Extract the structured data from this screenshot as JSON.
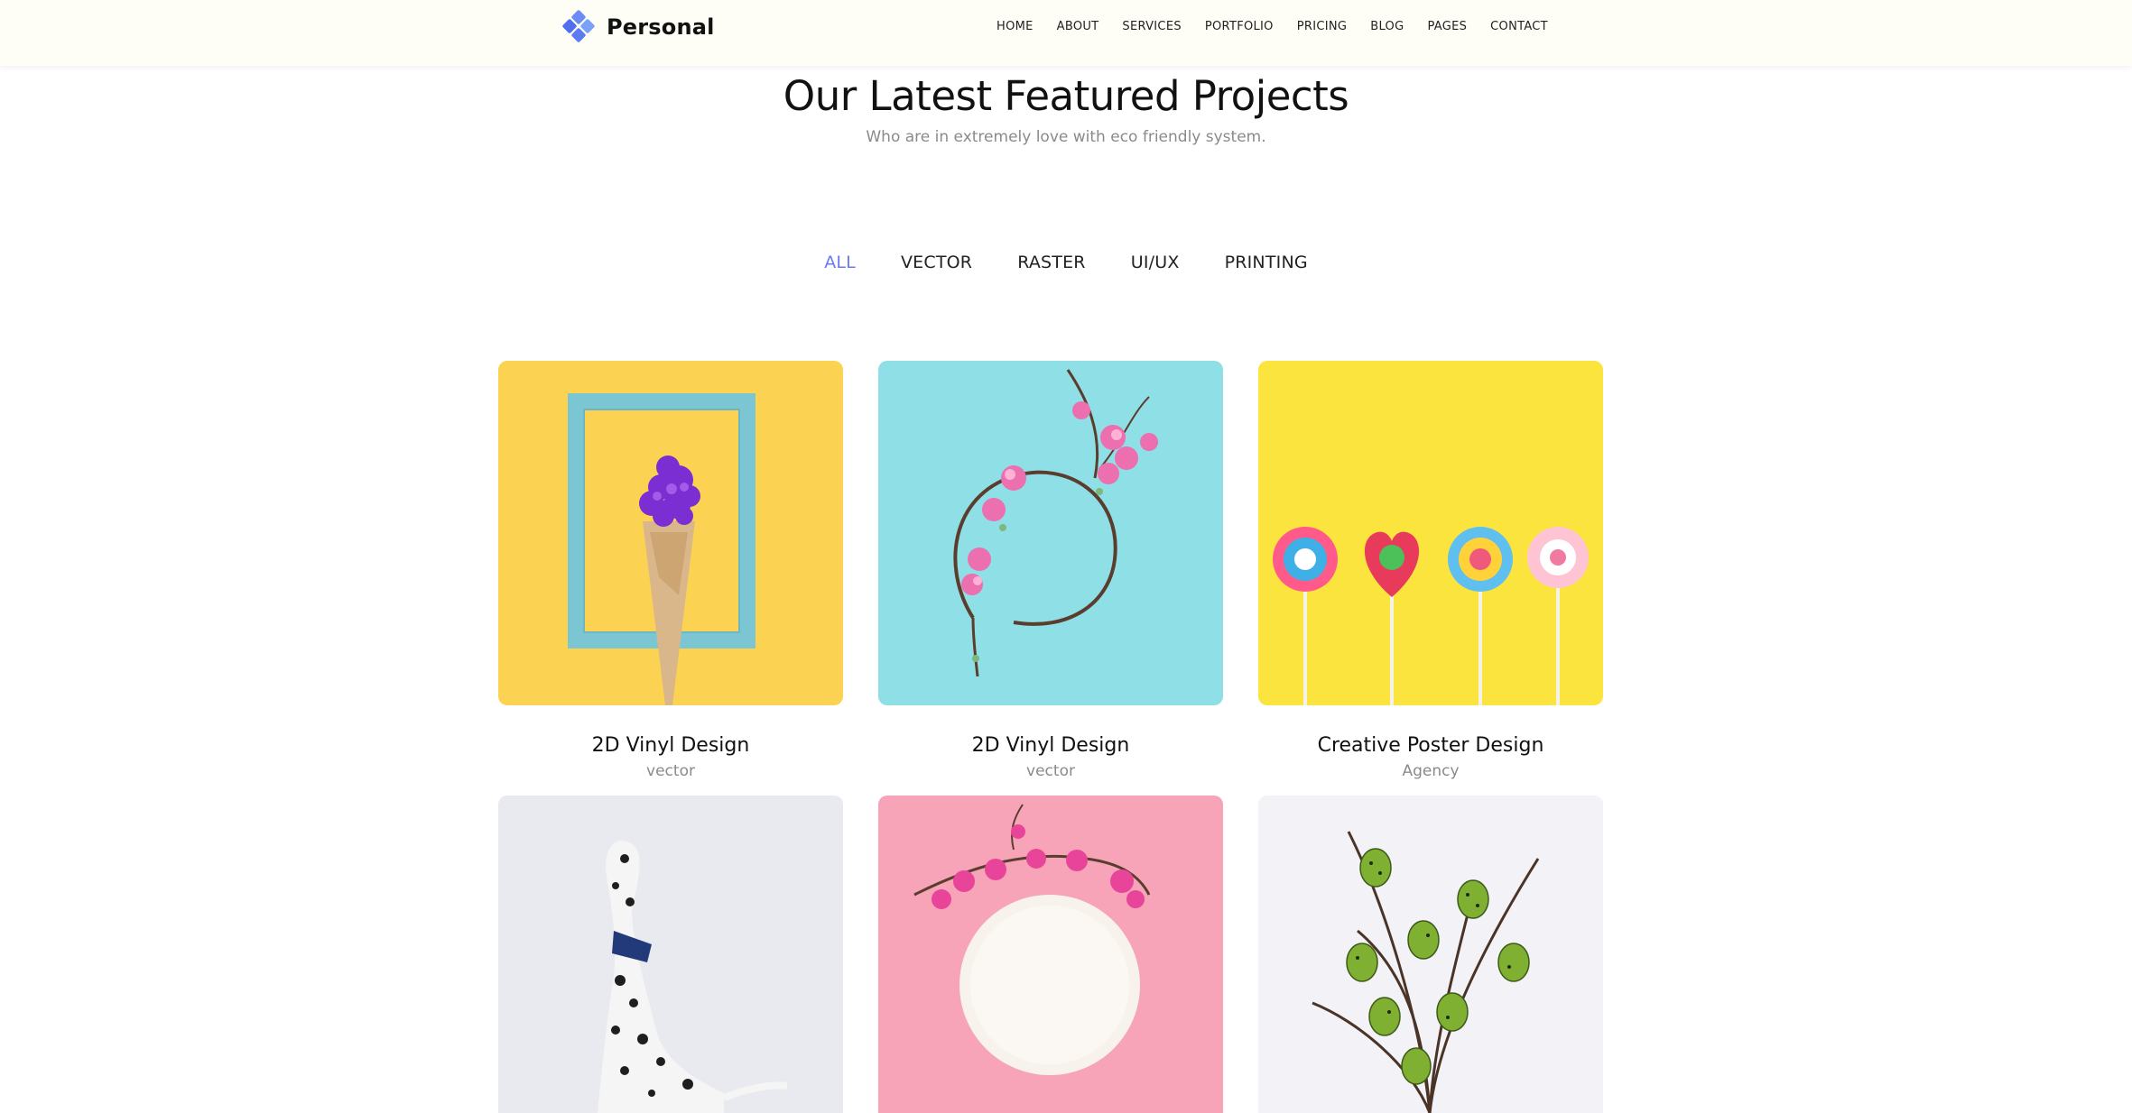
{
  "header": {
    "brand": "Personal",
    "nav": [
      "HOME",
      "ABOUT",
      "SERVICES",
      "PORTFOLIO",
      "PRICING",
      "BLOG",
      "PAGES",
      "CONTACT"
    ]
  },
  "section": {
    "title": "Our Latest Featured Projects",
    "subtitle": "Who are in extremely love with eco friendly system."
  },
  "filters": {
    "items": [
      "ALL",
      "VECTOR",
      "RASTER",
      "UI/UX",
      "PRINTING"
    ],
    "active": "ALL",
    "active_color": "#6c78f0"
  },
  "projects": [
    {
      "title": "2D Vinyl Design",
      "category": "vector",
      "image": "yellow-frame-ice-cream-flowers"
    },
    {
      "title": "2D Vinyl Design",
      "category": "vector",
      "image": "cyan-flower-wreath"
    },
    {
      "title": "Creative Poster Design",
      "category": "Agency",
      "image": "yellow-lollipops"
    },
    {
      "image": "dalmatian-dog"
    },
    {
      "image": "pink-plate-flowers"
    },
    {
      "image": "green-eggs-branches"
    }
  ]
}
